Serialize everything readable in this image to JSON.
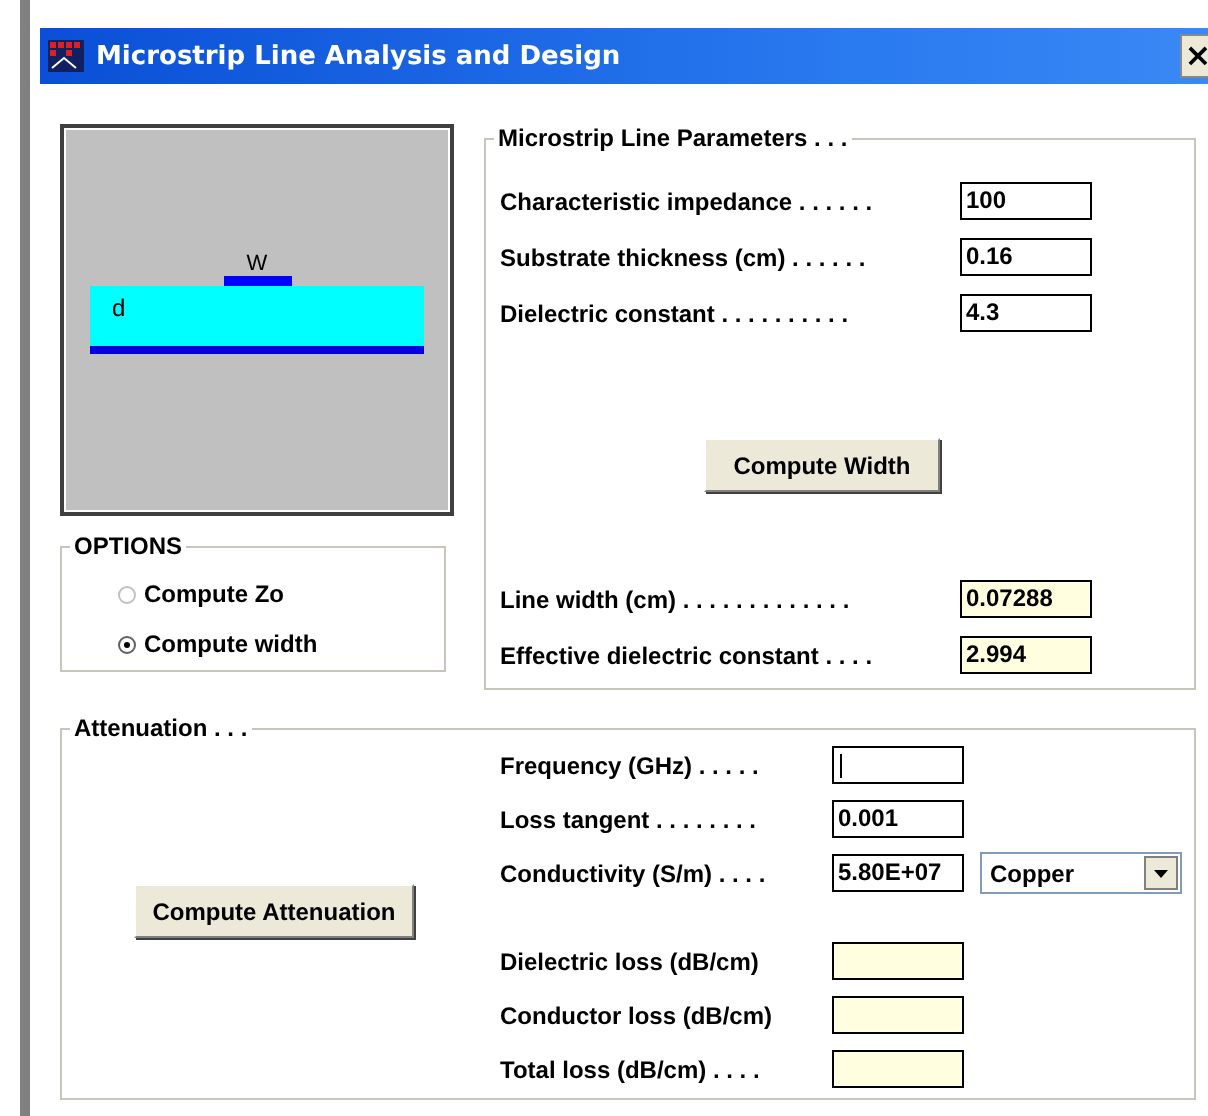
{
  "window": {
    "title": "Microstrip Line Analysis and Design",
    "close": "×"
  },
  "diagram": {
    "width_label": "W",
    "thickness_label": "d"
  },
  "options": {
    "title": "OPTIONS",
    "items": [
      {
        "label": "Compute Zo",
        "selected": false
      },
      {
        "label": "Compute width",
        "selected": true
      }
    ]
  },
  "parameters": {
    "title": "Microstrip Line Parameters . . .",
    "inputs": [
      {
        "label": "Characteristic impedance . . . . . .",
        "value": "100"
      },
      {
        "label": "Substrate thickness (cm) . . . . . .",
        "value": "0.16"
      },
      {
        "label": "Dielectric constant . . . . . . . . . .",
        "value": "4.3"
      }
    ],
    "button": "Compute Width",
    "outputs": [
      {
        "label": "Line width (cm) . . . . . . . . . . . . .",
        "value": "0.07288"
      },
      {
        "label": "Effective dielectric constant . . . .",
        "value": "2.994"
      }
    ]
  },
  "attenuation": {
    "title": "Attenuation . . .",
    "button": "Compute Attenuation",
    "inputs": [
      {
        "label": "Frequency (GHz) . . . . .",
        "focused": true
      },
      {
        "label": "Loss tangent . . . . . . . .",
        "value": "0.001",
        "focused": false
      },
      {
        "label": "Conductivity (S/m) . . . .",
        "value": "5.80E+07",
        "focused": false,
        "dropdown": "Copper"
      }
    ],
    "outputs": [
      {
        "label": "Dielectric loss (dB/cm)"
      },
      {
        "label": "Conductor loss (dB/cm)"
      },
      {
        "label": "Total loss (dB/cm) . . . ."
      }
    ]
  }
}
